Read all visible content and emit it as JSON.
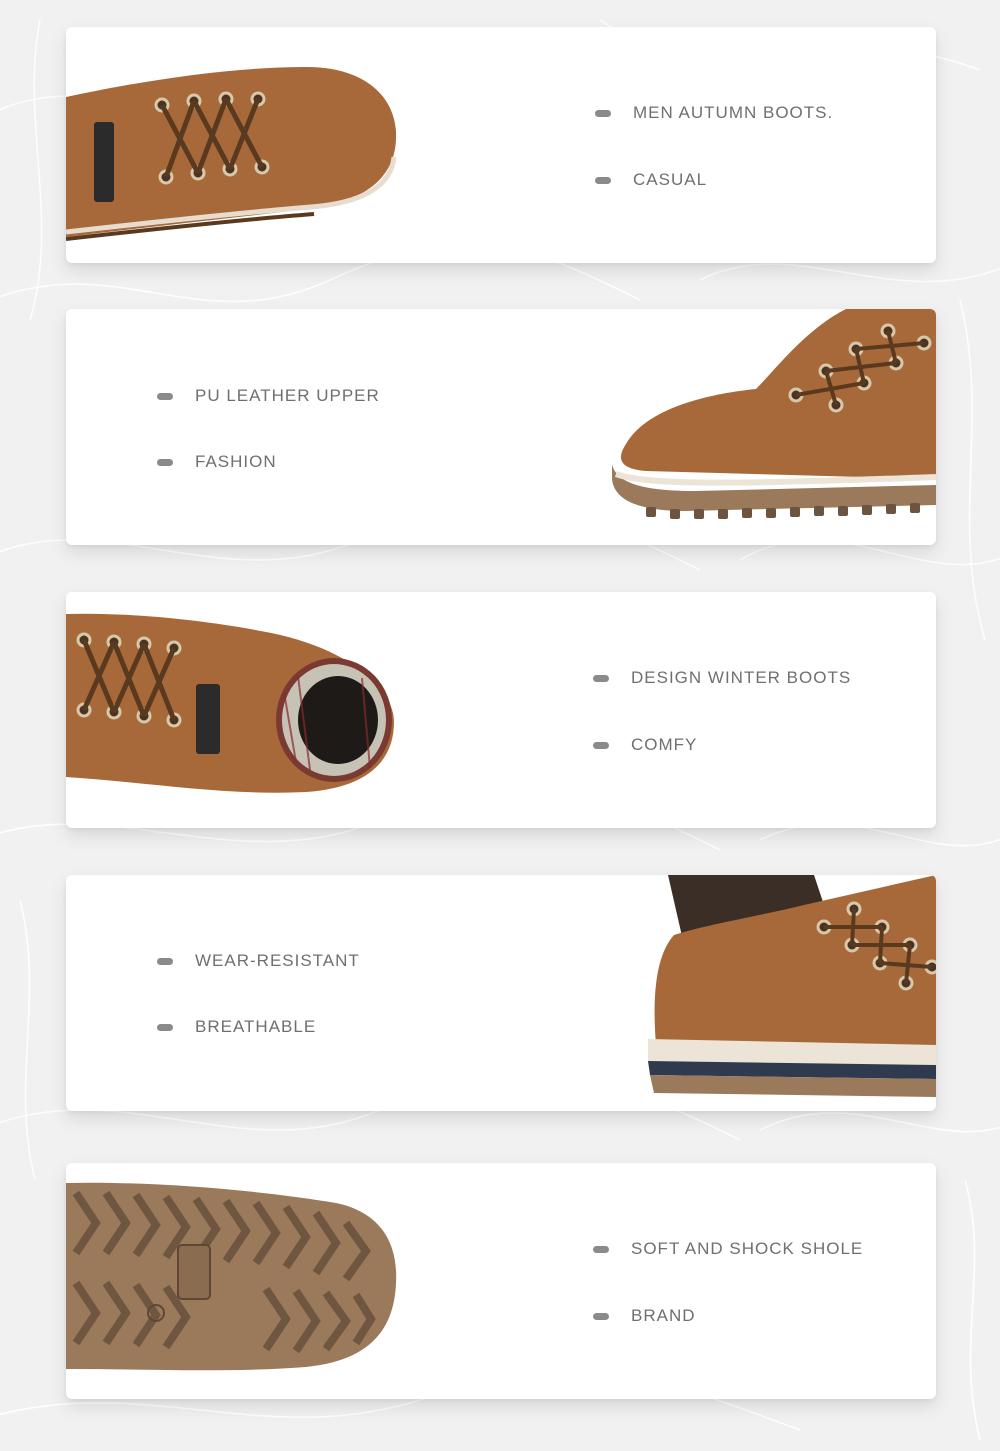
{
  "colors": {
    "background": "#f1f1f1",
    "card": "#ffffff",
    "text": "#6f6f6f",
    "bullet": "#8a8a8a",
    "leather": "#a8693a",
    "sole": "#9b7a5c"
  },
  "sections": [
    {
      "image": "boot-top-view-laces",
      "features": [
        "MEN AUTUMN BOOTS.",
        "CASUAL"
      ]
    },
    {
      "image": "boot-toe-side-view",
      "features": [
        "PU LEATHER UPPER",
        "FASHION"
      ]
    },
    {
      "image": "boot-plaid-lining-view",
      "features": [
        "DESIGN WINTER BOOTS",
        "COMFY"
      ]
    },
    {
      "image": "boot-heel-collar-view",
      "features": [
        "WEAR-RESISTANT",
        "BREATHABLE"
      ]
    },
    {
      "image": "boot-outsole-tread-view",
      "features": [
        "SOFT AND SHOCK SHOLE",
        "BRAND"
      ]
    }
  ]
}
